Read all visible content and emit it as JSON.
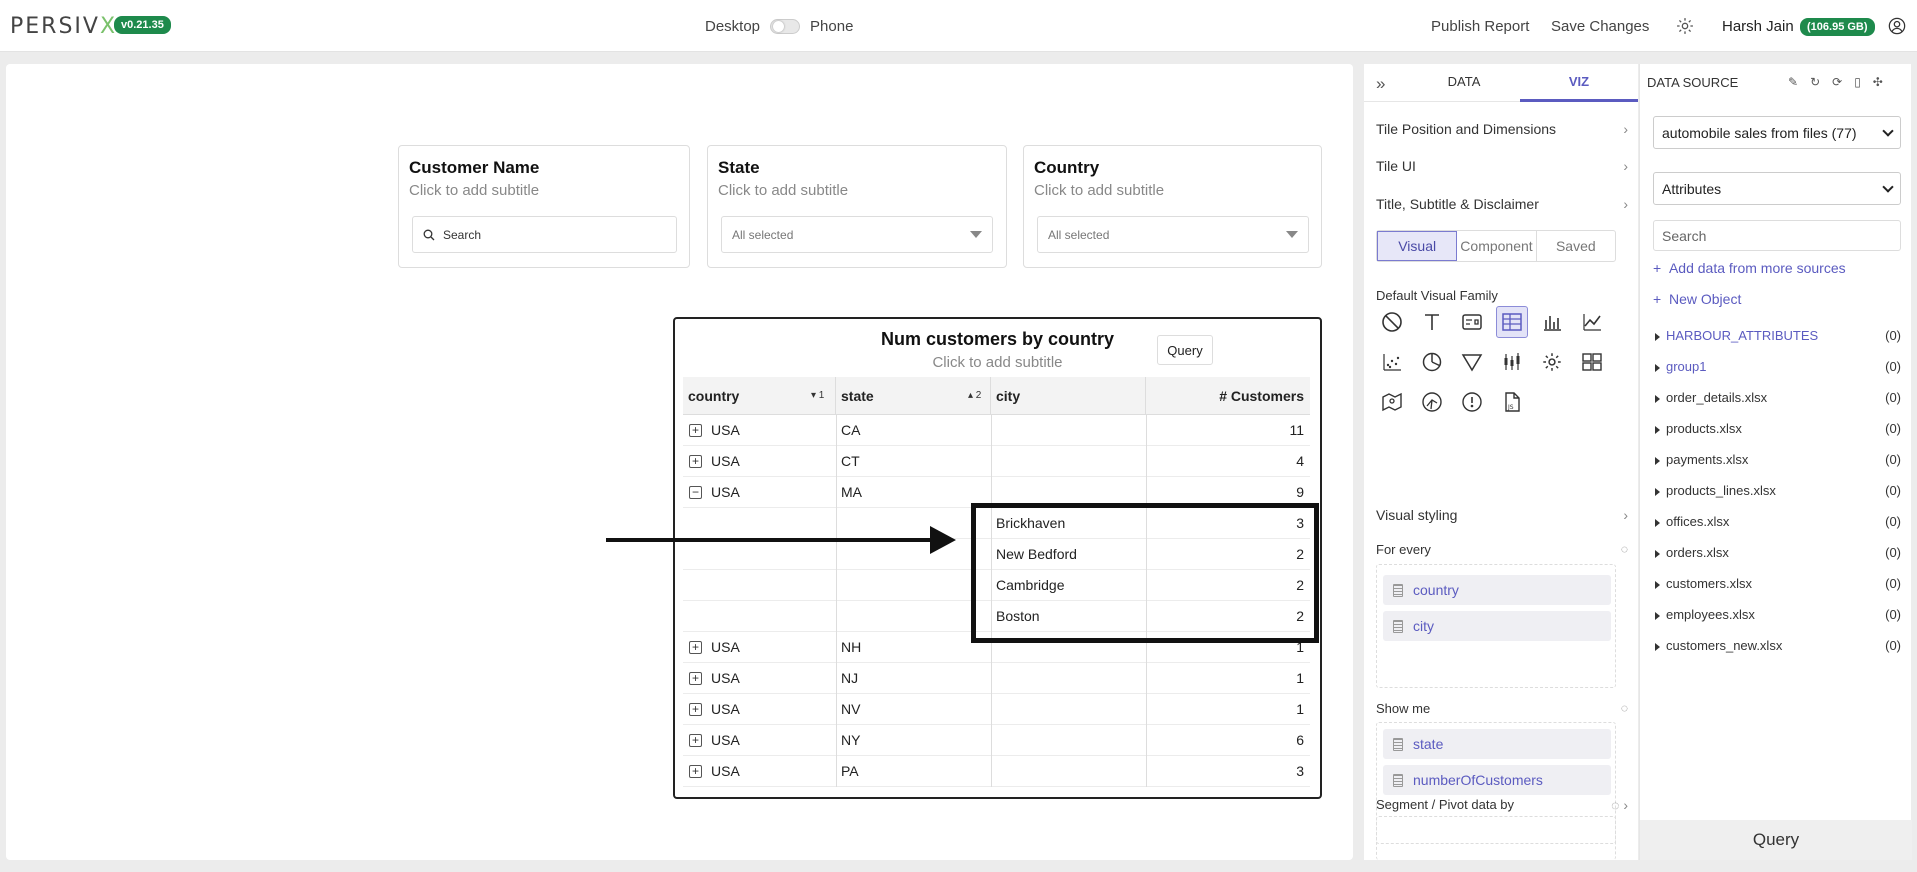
{
  "header": {
    "logo_main": "PERSIV",
    "logo_x": "X",
    "version": "v0.21.35",
    "mode_desktop": "Desktop",
    "mode_phone": "Phone",
    "publish": "Publish Report",
    "save": "Save Changes",
    "user": "Harsh Jain",
    "storage": "(106.95 GB)"
  },
  "filters": [
    {
      "title": "Customer Name",
      "subtitle": "Click to add subtitle",
      "placeholder": "Search"
    },
    {
      "title": "State",
      "subtitle": "Click to add subtitle",
      "value": "All selected"
    },
    {
      "title": "Country",
      "subtitle": "Click to add subtitle",
      "value": "All selected"
    }
  ],
  "table": {
    "title": "Num customers by country",
    "subtitle": "Click to add subtitle",
    "query_label": "Query",
    "columns": [
      "country",
      "state",
      "city",
      "# Customers"
    ],
    "sort_country": "▾ 1",
    "sort_state": "▴ 2",
    "rows": [
      {
        "exp": "+",
        "country": "USA",
        "state": "CA",
        "city": "",
        "n": "11"
      },
      {
        "exp": "+",
        "country": "USA",
        "state": "CT",
        "city": "",
        "n": "4"
      },
      {
        "exp": "−",
        "country": "USA",
        "state": "MA",
        "city": "",
        "n": "9"
      },
      {
        "exp": "",
        "country": "",
        "state": "",
        "city": "Brickhaven",
        "n": "3"
      },
      {
        "exp": "",
        "country": "",
        "state": "",
        "city": "New Bedford",
        "n": "2"
      },
      {
        "exp": "",
        "country": "",
        "state": "",
        "city": "Cambridge",
        "n": "2"
      },
      {
        "exp": "",
        "country": "",
        "state": "",
        "city": "Boston",
        "n": "2"
      },
      {
        "exp": "+",
        "country": "USA",
        "state": "NH",
        "city": "",
        "n": "1"
      },
      {
        "exp": "+",
        "country": "USA",
        "state": "NJ",
        "city": "",
        "n": "1"
      },
      {
        "exp": "+",
        "country": "USA",
        "state": "NV",
        "city": "",
        "n": "1"
      },
      {
        "exp": "+",
        "country": "USA",
        "state": "NY",
        "city": "",
        "n": "6"
      },
      {
        "exp": "+",
        "country": "USA",
        "state": "PA",
        "city": "",
        "n": "3"
      }
    ]
  },
  "viz_panel": {
    "tab_data": "DATA",
    "tab_viz": "VIZ",
    "tile_position": "Tile Position and Dimensions",
    "tile_ui": "Tile UI",
    "title_subtitle": "Title, Subtitle & Disclaimer",
    "seg_visual": "Visual",
    "seg_component": "Component",
    "seg_saved": "Saved",
    "default_family": "Default Visual Family",
    "visual_styling": "Visual styling",
    "for_every": "For every",
    "for_every_fields": [
      "country",
      "city"
    ],
    "show_me": "Show me",
    "show_me_fields": [
      "state",
      "numberOfCustomers"
    ],
    "segment": "Segment / Pivot data by"
  },
  "data_source": {
    "title": "DATA SOURCE",
    "source": "automobile sales from files (77)",
    "category": "Attributes",
    "search_placeholder": "Search",
    "add_more": "Add data from more sources",
    "new_object": "New Object",
    "items": [
      {
        "name": "HARBOUR_ATTRIBUTES",
        "count": "(0)",
        "accent": true
      },
      {
        "name": "group1",
        "count": "(0)",
        "accent": true
      },
      {
        "name": "order_details.xlsx",
        "count": "(0)"
      },
      {
        "name": "products.xlsx",
        "count": "(0)"
      },
      {
        "name": "payments.xlsx",
        "count": "(0)"
      },
      {
        "name": "products_lines.xlsx",
        "count": "(0)"
      },
      {
        "name": "offices.xlsx",
        "count": "(0)"
      },
      {
        "name": "orders.xlsx",
        "count": "(0)"
      },
      {
        "name": "customers.xlsx",
        "count": "(0)"
      },
      {
        "name": "employees.xlsx",
        "count": "(0)"
      },
      {
        "name": "customers_new.xlsx",
        "count": "(0)"
      }
    ],
    "query": "Query"
  },
  "colors": {
    "accent": "#5b5bc0",
    "badge": "#1e8a4c"
  }
}
